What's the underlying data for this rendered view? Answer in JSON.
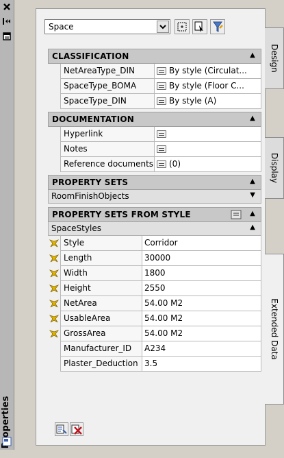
{
  "window": {
    "title": "Properties"
  },
  "toolbar": {
    "object_type": "Space"
  },
  "sections": {
    "classification": {
      "title": "CLASSIFICATION",
      "rows": [
        {
          "name": "NetAreaType_DIN",
          "value": "By style (Circulat..."
        },
        {
          "name": "SpaceType_BOMA",
          "value": "By style (Floor C..."
        },
        {
          "name": "SpaceType_DIN",
          "value": "By style (A)"
        }
      ]
    },
    "documentation": {
      "title": "DOCUMENTATION",
      "rows": [
        {
          "name": "Hyperlink",
          "value": ""
        },
        {
          "name": "Notes",
          "value": ""
        },
        {
          "name": "Reference documents",
          "value": "(0)"
        }
      ]
    },
    "property_sets": {
      "title": "PROPERTY SETS",
      "sub": "RoomFinishObjects"
    },
    "property_sets_from_style": {
      "title": "PROPERTY SETS FROM STYLE",
      "sub": "SpaceStyles",
      "rows": [
        {
          "name": "Style",
          "value": "Corridor"
        },
        {
          "name": "Length",
          "value": "30000"
        },
        {
          "name": "Width",
          "value": "1800"
        },
        {
          "name": "Height",
          "value": "2550"
        },
        {
          "name": "NetArea",
          "value": "54.00 M2"
        },
        {
          "name": "UsableArea",
          "value": "54.00 M2"
        },
        {
          "name": "GrossArea",
          "value": "54.00 M2"
        },
        {
          "name": "Manufacturer_ID",
          "value": "A234"
        },
        {
          "name": "Plaster_Deduction",
          "value": "3.5"
        }
      ]
    }
  },
  "tabs": [
    "Design",
    "Display",
    "Extended Data"
  ],
  "colors": {
    "panel_bg": "#f0f0f0",
    "header_bg": "#c8c8c8",
    "style_icon": "#e0b400"
  }
}
